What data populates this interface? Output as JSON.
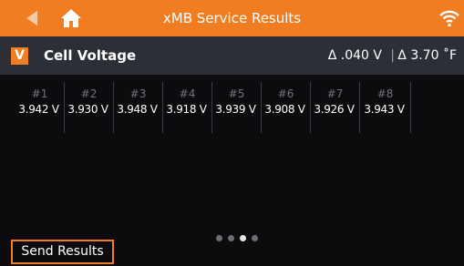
{
  "topbar": {
    "title": "xMB Service Results",
    "back_icon": "back-arrow-icon",
    "home_icon": "home-icon",
    "wifi_icon": "wifi-icon"
  },
  "header": {
    "badge": "V",
    "title": "Cell Voltage",
    "delta_voltage": "Δ .040 V",
    "separator": "|",
    "delta_temperature": "Δ 3.70 ˚F"
  },
  "cells": [
    {
      "label": "#1",
      "value": "3.942 V"
    },
    {
      "label": "#2",
      "value": "3.930 V"
    },
    {
      "label": "#3",
      "value": "3.948 V"
    },
    {
      "label": "#4",
      "value": "3.918 V"
    },
    {
      "label": "#5",
      "value": "3.939 V"
    },
    {
      "label": "#6",
      "value": "3.908 V"
    },
    {
      "label": "#7",
      "value": "3.926 V"
    },
    {
      "label": "#8",
      "value": "3.943 V"
    }
  ],
  "pager": {
    "total": 4,
    "active_index": 2
  },
  "actions": {
    "send_label": "Send Results"
  },
  "colors": {
    "accent": "#f07d22",
    "header_bg": "#2c3036",
    "background": "#0c0c0e"
  }
}
